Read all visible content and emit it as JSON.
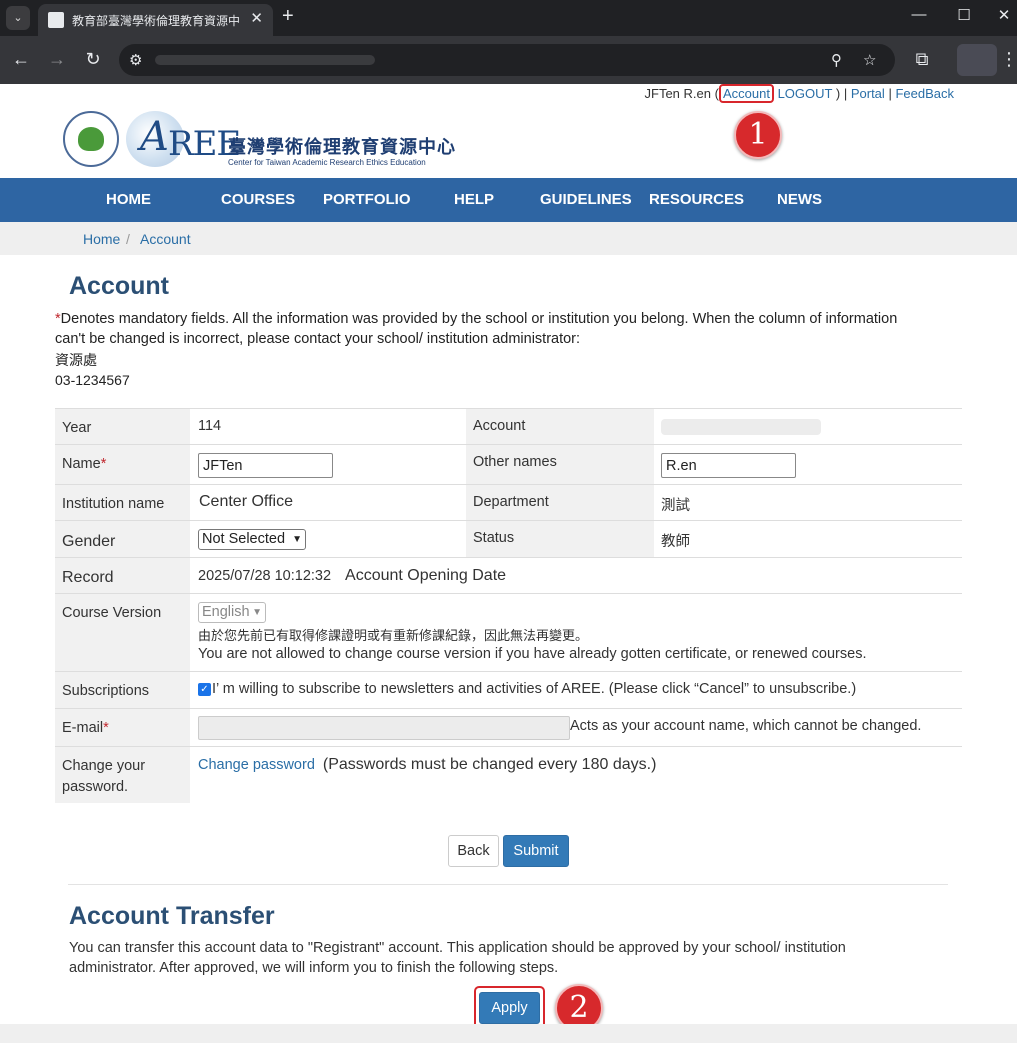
{
  "browser": {
    "tab_title": "教育部臺灣學術倫理教育資源中",
    "tab_close": "✕",
    "new_tab": "+",
    "tab_menu": "⌄",
    "window_controls": {
      "minimize": "—",
      "maximize": "☐",
      "close": "✕"
    },
    "nav": {
      "back": "←",
      "forward": "→",
      "reload": "↻"
    },
    "omnibox_icons": {
      "site_info": "⚙",
      "zoom": "⚲",
      "bookmark": "☆"
    },
    "extensions_icon": "⧉",
    "menu_icon": "⋮"
  },
  "userbar": {
    "name": "JFTen R.en",
    "open_paren": "(",
    "account": "Account",
    "logout": "LOGOUT",
    "close_paren": ")",
    "sep1": "|",
    "portal": "Portal",
    "sep2": "|",
    "feedback": "FeedBack"
  },
  "logo": {
    "a": "A",
    "ree": "REE",
    "cn_title": "臺灣學術倫理教育資源中心",
    "en_title": "Center for Taiwan Academic Research Ethics Education"
  },
  "markers": {
    "one": "1",
    "two": "2"
  },
  "nav": [
    "HOME",
    "COURSES",
    "PORTFOLIO",
    "HELP",
    "GUIDELINES",
    "RESOURCES",
    "NEWS"
  ],
  "breadcrumb": {
    "home": "Home",
    "sep": "/",
    "current": "Account"
  },
  "account": {
    "heading": "Account",
    "asterisk": "*",
    "notice": "Denotes mandatory fields. All the information was provided by the school or institution you belong. When the column of information can't be changed is incorrect, please contact your school/ institution administrator:",
    "contact_unit": "資源處",
    "contact_phone": "03-1234567"
  },
  "form": {
    "year_label": "Year",
    "year_value": "114",
    "account_label": "Account",
    "name_label": "Name",
    "name_value": "JFTen",
    "other_names_label": "Other names",
    "other_names_value": "R.en",
    "institution_label": "Institution name",
    "institution_value": "Center Office",
    "department_label": "Department",
    "department_value": "測試",
    "gender_label": "Gender",
    "gender_value": "Not Selected",
    "status_label": "Status",
    "status_value": "教師",
    "record_label": "Record",
    "record_date": "2025/07/28 10:12:32",
    "record_desc": "Account Opening Date",
    "course_version_label": "Course Version",
    "course_version_value": "English",
    "course_version_note_cn": "由於您先前已有取得修課證明或有重新修課紀錄，因此無法再變更。",
    "course_version_note_en": "You are not allowed to change course version if you have already gotten certificate, or renewed courses.",
    "subscriptions_label": "Subscriptions",
    "subscriptions_text": "I’ m willing to subscribe to newsletters and activities of AREE. (Please click “Cancel” to unsubscribe.)",
    "email_label": "E-mail",
    "email_note": "Acts as your account name, which cannot be changed.",
    "password_label": "Change your password.",
    "password_link": "Change password",
    "password_note": "(Passwords must be changed every 180 days.)"
  },
  "buttons": {
    "back": "Back",
    "submit": "Submit",
    "apply": "Apply"
  },
  "transfer": {
    "heading": "Account Transfer",
    "text": "You can transfer this account data to \"Registrant\" account. This application should be approved by your school/ institution administrator. After approved, we will inform you to finish the following steps."
  }
}
